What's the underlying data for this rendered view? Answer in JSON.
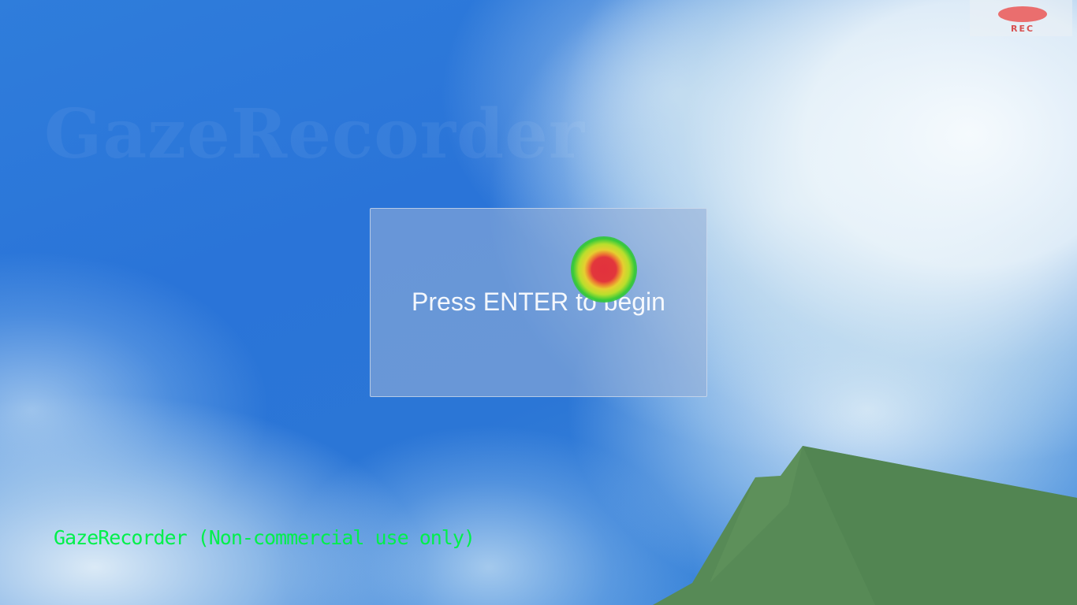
{
  "scene": {
    "watermark": "GazeRecorder",
    "sky_color": "#2b76d6",
    "hill_color": "#578a56"
  },
  "recorder": {
    "label": "REC",
    "dot_color": "#ea6e6e"
  },
  "start_panel": {
    "prompt": "Press ENTER to begin"
  },
  "gaze_marker": {
    "icon": "gaze-heatmap-icon"
  },
  "footer": {
    "license_text": "GazeRecorder (Non-commercial use only)",
    "license_color": "#00f04a"
  }
}
